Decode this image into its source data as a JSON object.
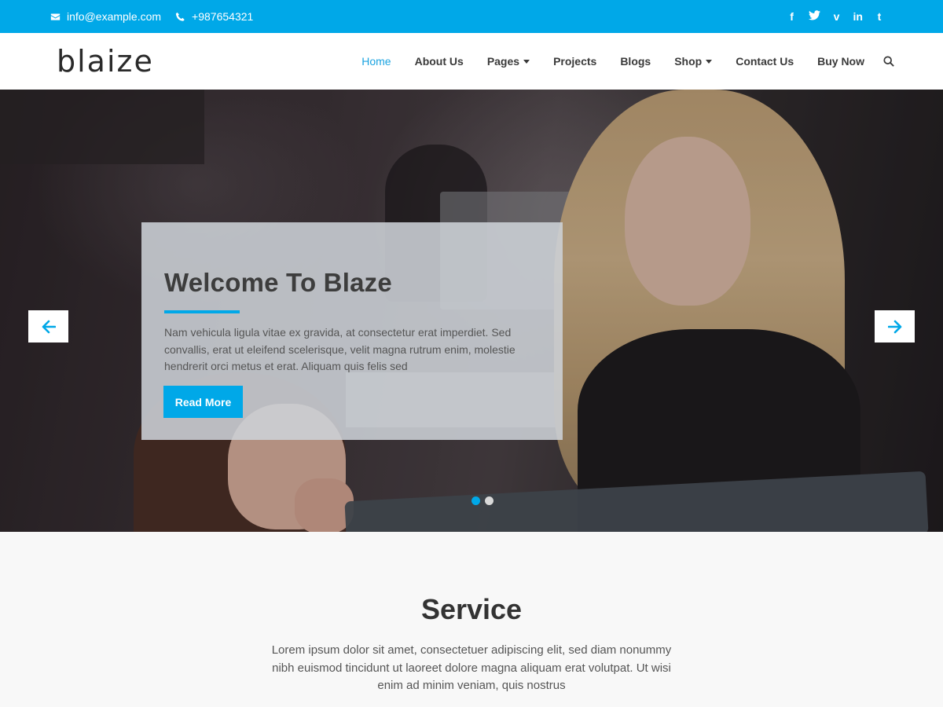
{
  "topbar": {
    "email": "info@example.com",
    "phone": "+987654321",
    "social": {
      "facebook": "f",
      "twitter": "t",
      "vimeo": "v",
      "linkedin": "in",
      "tumblr": "t"
    }
  },
  "header": {
    "logo": "blaize",
    "nav": [
      {
        "label": "Home"
      },
      {
        "label": "About Us"
      },
      {
        "label": "Pages"
      },
      {
        "label": "Projects"
      },
      {
        "label": "Blogs"
      },
      {
        "label": "Shop"
      },
      {
        "label": "Contact Us"
      },
      {
        "label": "Buy Now"
      }
    ]
  },
  "hero": {
    "title": "Welcome To Blaze",
    "text": "Nam vehicula ligula vitae ex gravida, at consectetur erat imperdiet. Sed convallis, erat ut eleifend scelerisque, velit magna rutrum enim, molestie hendrerit orci metus et erat. Aliquam quis felis sed",
    "button_label": "Read More",
    "slides_total": 2,
    "active_slide": 1
  },
  "service": {
    "heading": "Service",
    "description": "Lorem ipsum dolor sit amet, consectetuer adipiscing elit, sed diam nonummy nibh euismod tincidunt ut laoreet dolore magna aliquam erat volutpat. Ut wisi enim ad minim veniam, quis nostrus"
  },
  "colors": {
    "accent": "#00a8e8",
    "nav_active": "#1aa3e0",
    "text_dark": "#333333"
  },
  "icons": [
    "envelope-icon",
    "phone-icon",
    "facebook-icon",
    "twitter-icon",
    "vimeo-icon",
    "linkedin-icon",
    "tumblr-icon",
    "caret-down-icon",
    "search-icon",
    "arrow-left-icon",
    "arrow-right-icon"
  ]
}
